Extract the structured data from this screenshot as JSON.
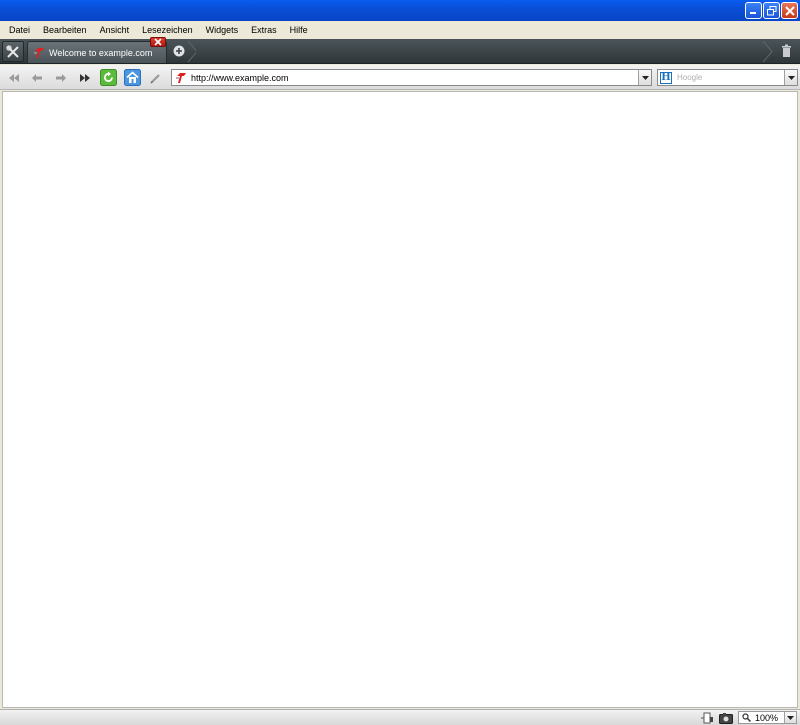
{
  "menu": {
    "items": [
      "Datei",
      "Bearbeiten",
      "Ansicht",
      "Lesezeichen",
      "Widgets",
      "Extras",
      "Hilfe"
    ]
  },
  "tabs": [
    {
      "title": "Welcome to example.com",
      "icon": "opera-logo-icon"
    }
  ],
  "navigation": {
    "buttons": [
      "rewind-icon",
      "back-icon",
      "forward-icon",
      "fast-forward-icon",
      "reload-icon",
      "home-icon",
      "edit-icon"
    ],
    "url": "http://www.example.com"
  },
  "search": {
    "engine_letter": "H",
    "placeholder": "Hoogle"
  },
  "statusbar": {
    "zoom": "100%"
  },
  "colors": {
    "titlebar": "#0a4fd8",
    "tabbar": "#3b4346",
    "close_red": "#c7361a",
    "reload_green": "#4caf32",
    "home_blue": "#3a86d8"
  }
}
